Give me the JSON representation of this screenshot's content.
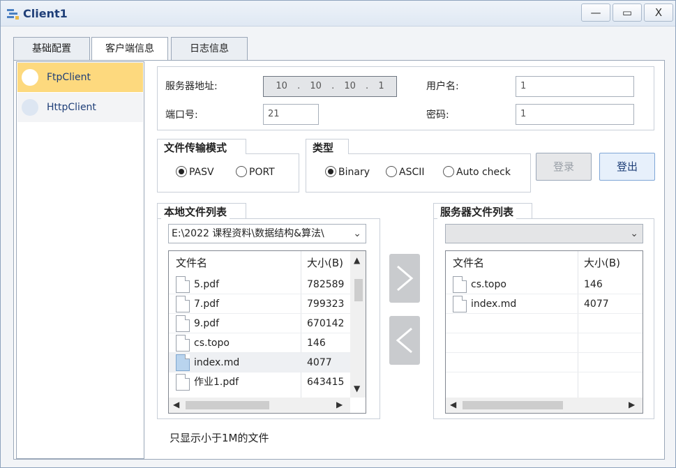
{
  "window": {
    "title": "Client1",
    "controls": {
      "minimize": "—",
      "maximize": "▭",
      "close": "X"
    }
  },
  "tabs": [
    {
      "label": "基础配置"
    },
    {
      "label": "客户端信息"
    },
    {
      "label": "日志信息"
    }
  ],
  "client_list": [
    {
      "label": "FtpClient",
      "selected": true
    },
    {
      "label": "HttpClient",
      "selected": false
    }
  ],
  "connection": {
    "server_label": "服务器地址:",
    "ip": [
      "10",
      "10",
      "10",
      "1"
    ],
    "port_label": "端口号:",
    "port_value": "21",
    "user_label": "用户名:",
    "user_value": "1",
    "password_label": "密码:",
    "password_value": "1"
  },
  "transfer_mode": {
    "title": "文件传输模式",
    "options": [
      "PASV",
      "PORT"
    ],
    "selected": "PASV"
  },
  "type": {
    "title": "类型",
    "options": [
      "Binary",
      "ASCII",
      "Auto check"
    ],
    "selected": "Binary"
  },
  "buttons": {
    "login": "登录",
    "logout": "登出"
  },
  "local_files": {
    "title": "本地文件列表",
    "path": "E:\\2022 课程资料\\数据结构&算法\\",
    "columns": [
      "文件名",
      "大小(B)"
    ],
    "rows": [
      {
        "name": "5.pdf",
        "size": "782589"
      },
      {
        "name": "7.pdf",
        "size": "799323"
      },
      {
        "name": "9.pdf",
        "size": "670142"
      },
      {
        "name": "cs.topo",
        "size": "146"
      },
      {
        "name": "index.md",
        "size": "4077"
      },
      {
        "name": "作业1.pdf",
        "size": "643415"
      }
    ]
  },
  "server_files": {
    "title": "服务器文件列表",
    "path": "",
    "columns": [
      "文件名",
      "大小(B)"
    ],
    "rows": [
      {
        "name": "cs.topo",
        "size": "146"
      },
      {
        "name": "index.md",
        "size": "4077"
      }
    ]
  },
  "footer_note": "只显示小于1M的文件",
  "colors": {
    "selected_item": "#fdd97e",
    "title_text": "#1f3f78",
    "button_disabled": "#e6e7e9",
    "button_enabled": "#e7f0fb"
  }
}
